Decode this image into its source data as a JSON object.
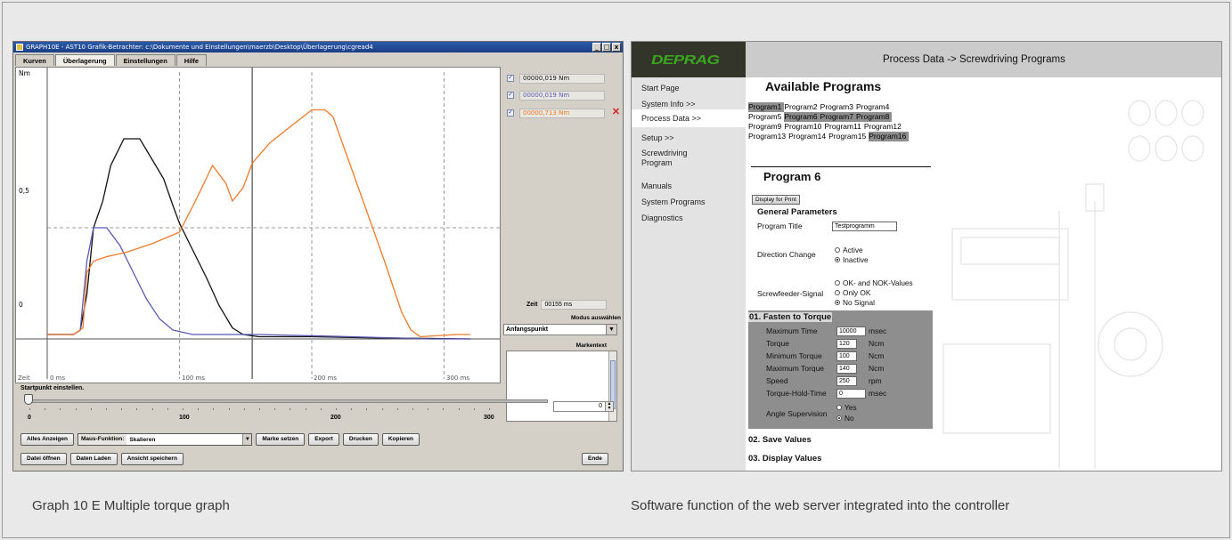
{
  "left_window": {
    "title": "GRAPH10E - AST10 Grafik-Betrachter: c:\\Dokumente und Einstellungen\\maerzb\\Desktop\\Überlagerung\\cgread4",
    "window_buttons": [
      "_",
      "□",
      "x"
    ],
    "tabs": [
      {
        "label": "Kurven",
        "active": false
      },
      {
        "label": "Überlagerung",
        "active": true
      },
      {
        "label": "Einstellungen",
        "active": false
      },
      {
        "label": "Hilfe",
        "active": false
      }
    ],
    "plot": {
      "y_unit": "Nm",
      "y_ticks": [
        "0,5",
        "0"
      ],
      "x_prefix": "Zeit",
      "x_ticks": [
        "0 ms",
        "100 ms",
        "200 ms",
        "300 ms"
      ]
    },
    "legend": [
      {
        "value": "00000,019 Nm",
        "color": "#111111"
      },
      {
        "value": "00000,019 Nm",
        "color": "#5a5ab4"
      },
      {
        "value": "00000,713 Nm",
        "color": "#f07a28"
      }
    ],
    "zeit_label": "Zeit",
    "zeit_value": "00155 ms",
    "modus_label": "Modus auswählen",
    "modus_value": "Anfangspunkt",
    "markertext_label": "Markentext",
    "startpoint_label": "Startpunkt einstellen.",
    "slider_ticks": [
      "0",
      "100",
      "200",
      "300"
    ],
    "spinner_value": "0",
    "buttons_row1": [
      "Alles Anzeigen",
      "Marke setzen",
      "Export",
      "Drucken",
      "Kopieren"
    ],
    "maus_label": "Maus-Funktion:",
    "maus_value": "Skalieren",
    "buttons_row2": [
      "Datei öffnen",
      "Daten Laden",
      "Ansicht speichern"
    ],
    "ende_label": "Ende"
  },
  "chart_data": {
    "type": "line",
    "xlabel": "Zeit",
    "ylabel": "Nm",
    "xlim": [
      0,
      330
    ],
    "ylim": [
      -0.1,
      1.2
    ],
    "grid": true,
    "series": [
      {
        "color": "#111111",
        "points": [
          [
            0,
            0.02
          ],
          [
            20,
            0.02
          ],
          [
            25,
            0.04
          ],
          [
            30,
            0.2
          ],
          [
            35,
            0.5
          ],
          [
            42,
            0.62
          ],
          [
            48,
            0.78
          ],
          [
            58,
            0.9
          ],
          [
            70,
            0.9
          ],
          [
            80,
            0.8
          ],
          [
            88,
            0.72
          ],
          [
            95,
            0.6
          ],
          [
            100,
            0.52
          ],
          [
            110,
            0.4
          ],
          [
            120,
            0.28
          ],
          [
            130,
            0.15
          ],
          [
            140,
            0.05
          ],
          [
            148,
            0.02
          ],
          [
            160,
            0.01
          ],
          [
            200,
            0.01
          ],
          [
            250,
            0.005
          ],
          [
            320,
            0.0
          ]
        ]
      },
      {
        "color": "#5a5ab4",
        "points": [
          [
            0,
            0.02
          ],
          [
            20,
            0.02
          ],
          [
            25,
            0.04
          ],
          [
            30,
            0.35
          ],
          [
            35,
            0.5
          ],
          [
            45,
            0.5
          ],
          [
            55,
            0.42
          ],
          [
            65,
            0.3
          ],
          [
            75,
            0.18
          ],
          [
            85,
            0.09
          ],
          [
            95,
            0.04
          ],
          [
            110,
            0.02
          ],
          [
            160,
            0.02
          ],
          [
            230,
            0.01
          ],
          [
            290,
            0.0
          ],
          [
            320,
            0.0
          ]
        ]
      },
      {
        "color": "#f07a28",
        "points": [
          [
            0,
            0.02
          ],
          [
            20,
            0.02
          ],
          [
            27,
            0.05
          ],
          [
            30,
            0.3
          ],
          [
            35,
            0.35
          ],
          [
            45,
            0.37
          ],
          [
            60,
            0.39
          ],
          [
            80,
            0.43
          ],
          [
            100,
            0.48
          ],
          [
            112,
            0.62
          ],
          [
            125,
            0.78
          ],
          [
            135,
            0.7
          ],
          [
            140,
            0.62
          ],
          [
            148,
            0.68
          ],
          [
            155,
            0.79
          ],
          [
            168,
            0.88
          ],
          [
            185,
            0.96
          ],
          [
            200,
            1.03
          ],
          [
            210,
            1.03
          ],
          [
            216,
            1.0
          ],
          [
            225,
            0.85
          ],
          [
            240,
            0.6
          ],
          [
            255,
            0.35
          ],
          [
            268,
            0.12
          ],
          [
            275,
            0.04
          ],
          [
            282,
            0.01
          ],
          [
            310,
            0.02
          ],
          [
            320,
            0.02
          ]
        ]
      }
    ]
  },
  "right_window": {
    "logo": "DEPRAG",
    "header": "Process Data -> Screwdriving Programs",
    "nav": [
      "Start Page",
      "System Info >>",
      "Process Data >>",
      "Setup >>",
      "Screwdriving Program",
      "Manuals",
      "System Programs",
      "Diagnostics"
    ],
    "nav_active": "Process Data >>",
    "available_title": "Available Programs",
    "programs": [
      [
        "Program1",
        "Program2",
        "Program3",
        "Program4"
      ],
      [
        "Program5",
        "Program6",
        "Program7",
        "Program8"
      ],
      [
        "Program9",
        "Program10",
        "Program11",
        "Program12"
      ],
      [
        "Program13",
        "Program14",
        "Program15",
        "Program16"
      ]
    ],
    "highlighted_programs": [
      "Program1",
      "Program6",
      "Program7",
      "Program8",
      "Program16"
    ],
    "program_title": "Program 6",
    "display_button": "Display for Print",
    "general_title": "General Parameters",
    "program_title_label": "Program Title",
    "program_title_value": "Testprogramm",
    "direction_label": "Direction Change",
    "direction_options": [
      "Active",
      "Inactive"
    ],
    "direction_selected": "Inactive",
    "feeder_label": "Screwfeeder-Signal",
    "feeder_options": [
      "OK- and NOK-Values",
      "Only OK",
      "No Signal"
    ],
    "feeder_selected": "No Signal",
    "step1_title": "01. Fasten to Torque",
    "step1_params": [
      {
        "label": "Maximum Time",
        "value": "10000",
        "unit": "msec"
      },
      {
        "label": "Torque",
        "value": "120",
        "unit": "Ncm"
      },
      {
        "label": "Minimum Torque",
        "value": "100",
        "unit": "Ncm"
      },
      {
        "label": "Maximum Torque",
        "value": "140",
        "unit": "Ncm"
      },
      {
        "label": "Speed",
        "value": "250",
        "unit": "rpm"
      },
      {
        "label": "Torque-Hold-Time",
        "value": "0",
        "unit": "msec"
      }
    ],
    "angle_label": "Angle Supervision",
    "angle_options": [
      "Yes",
      "No"
    ],
    "angle_selected": "No",
    "step2_title": "02. Save Values",
    "step3_title": "03. Display Values"
  },
  "captions": {
    "left": "Graph 10 E   Multiple torque graph",
    "right": "Software function of the web server integrated into the controller"
  }
}
